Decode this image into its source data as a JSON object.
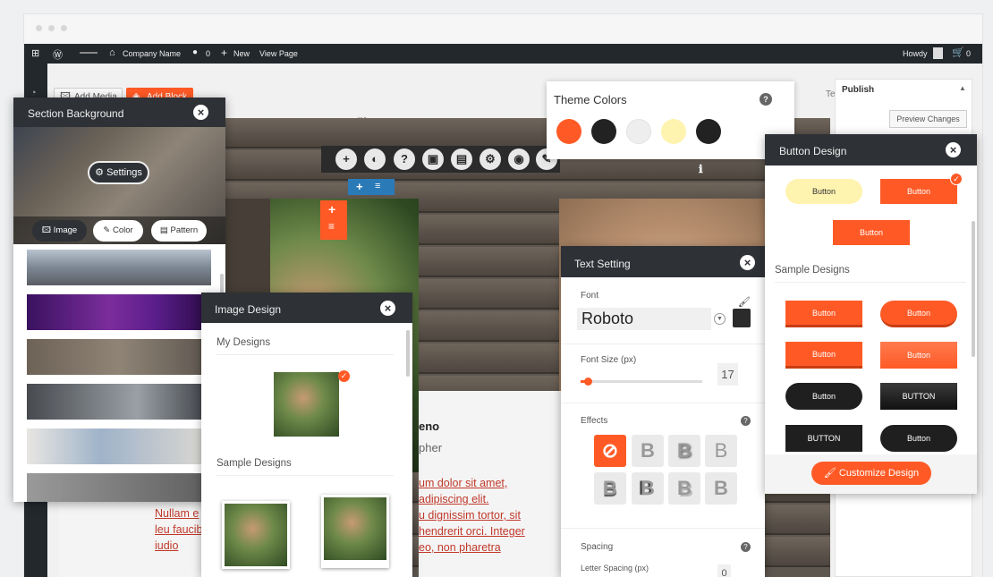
{
  "admin_bar": {
    "site": "Company Name",
    "comments": "0",
    "new": "New",
    "view": "View Page",
    "howdy": "Howdy"
  },
  "toolbar": {
    "add_media": "Add Media",
    "add_block": "Add Block",
    "text_tab": "Text",
    "publish": "Publish",
    "preview": "Preview Changes"
  },
  "section_background": {
    "title": "Section Background",
    "settings": "Settings",
    "tabs": [
      "Image",
      "Color",
      "Pattern"
    ]
  },
  "image_design": {
    "title": "Image Design",
    "my_designs": "My Designs",
    "sample_designs": "Sample Designs"
  },
  "theme_colors": {
    "title": "Theme Colors",
    "colors": [
      "#ff5a26",
      "#222222",
      "#eeeeee",
      "#fff3b0",
      "#222222"
    ]
  },
  "text_setting": {
    "title": "Text Setting",
    "font_label": "Font",
    "font_value": "Roboto",
    "font_size_label": "Font Size (px)",
    "font_size_value": "17",
    "font_size_fraction": 0.06,
    "effects_label": "Effects",
    "spacing_label": "Spacing",
    "letter_spacing_label": "Letter Spacing (px)",
    "letter_spacing_value": "0"
  },
  "button_design": {
    "title": "Button Design",
    "top_buttons": [
      "Button",
      "Button",
      "Button"
    ],
    "sample_label": "Sample Designs",
    "samples": [
      "Button",
      "Button",
      "Button",
      "Button",
      "Button",
      "BUTTON",
      "BUTTON",
      "Button"
    ],
    "customize": "Customize Design"
  },
  "page_content": {
    "name_fragment": "eno",
    "role_fragment": "pher",
    "lorem_lines": [
      "um dolor sit amet,",
      "adipiscing elit.",
      "u dignissim tortor, sit",
      "hendrerit orci. Integer",
      "eo, non pharetra"
    ],
    "left_lines": [
      "Nullam e",
      "leu faucib",
      "iudio"
    ]
  },
  "colors": {
    "accent": "#ff5a26",
    "dark": "#2e3136"
  }
}
